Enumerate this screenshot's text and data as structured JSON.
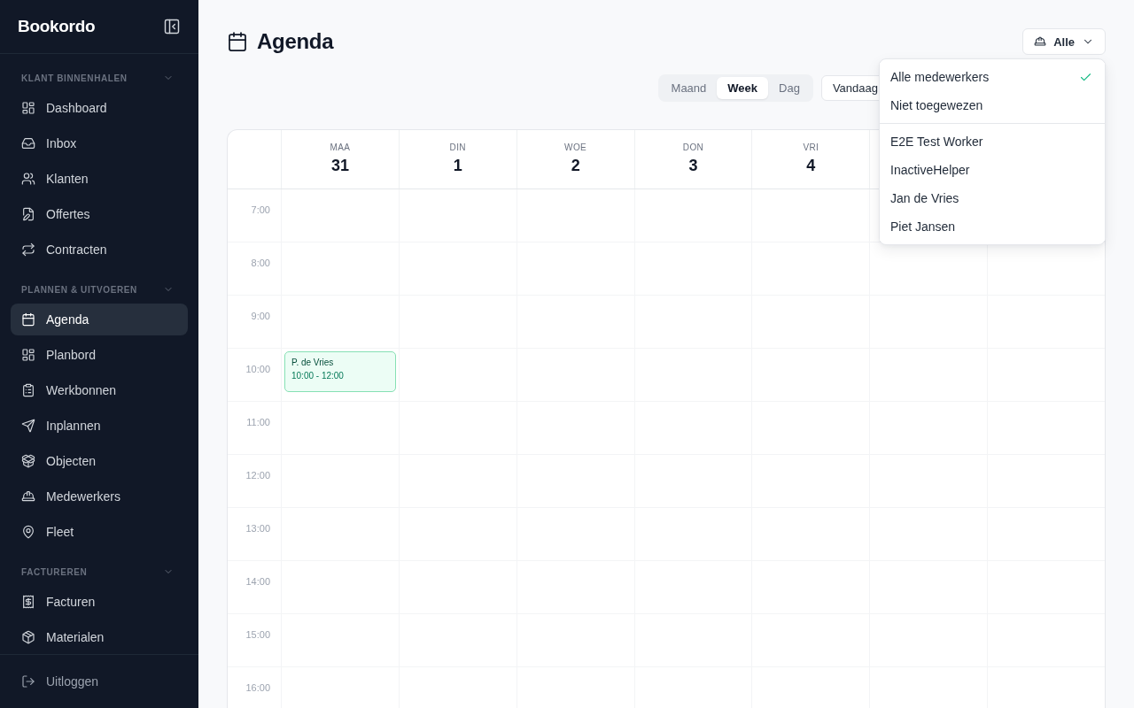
{
  "sidebar": {
    "logo": "Bookordo",
    "sections": [
      {
        "title": "KLANT BINNENHALEN",
        "expanded": true,
        "items": [
          {
            "label": "Dashboard",
            "selected": false
          },
          {
            "label": "Inbox",
            "selected": false
          },
          {
            "label": "Klanten",
            "selected": false
          },
          {
            "label": "Offertes",
            "selected": false
          },
          {
            "label": "Contracten",
            "selected": false
          }
        ]
      },
      {
        "title": "PLANNEN & UITVOEREN",
        "expanded": true,
        "items": [
          {
            "label": "Agenda",
            "selected": true
          },
          {
            "label": "Planbord",
            "selected": false
          },
          {
            "label": "Werkbonnen",
            "selected": false
          },
          {
            "label": "Inplannen",
            "selected": false
          },
          {
            "label": "Objecten",
            "selected": false
          },
          {
            "label": "Medewerkers",
            "selected": false
          },
          {
            "label": "Fleet",
            "selected": false
          }
        ]
      },
      {
        "title": "FACTUREREN",
        "expanded": true,
        "items": [
          {
            "label": "Facturen",
            "selected": false
          },
          {
            "label": "Materialen",
            "selected": false
          }
        ]
      }
    ],
    "footer": {
      "label": "Uitloggen"
    }
  },
  "header": {
    "title": "Agenda",
    "filter": {
      "value": "Alle",
      "open": true,
      "menu": {
        "groups": [
          {
            "items": [
              {
                "label": "Alle medewerkers",
                "selected": true
              },
              {
                "label": "Niet toegewezen",
                "selected": false
              }
            ]
          },
          {
            "items": [
              {
                "label": "E2E Test Worker",
                "selected": false
              },
              {
                "label": "InactiveHelper",
                "selected": false
              },
              {
                "label": "Jan de Vries",
                "selected": false
              },
              {
                "label": "Piet Jansen",
                "selected": false
              }
            ]
          }
        ]
      }
    }
  },
  "toolbar": {
    "views": [
      {
        "label": "Maand",
        "selected": false
      },
      {
        "label": "Week",
        "selected": true
      },
      {
        "label": "Dag",
        "selected": false
      }
    ],
    "today": "Vandaag"
  },
  "calendar": {
    "days": [
      {
        "weekday": "MAA",
        "date": "31"
      },
      {
        "weekday": "DIN",
        "date": "1"
      },
      {
        "weekday": "WOE",
        "date": "2"
      },
      {
        "weekday": "DON",
        "date": "3"
      },
      {
        "weekday": "VRI",
        "date": "4"
      }
    ],
    "rows": [
      {
        "time": "7:00"
      },
      {
        "time": "8:00"
      },
      {
        "time": "9:00"
      },
      {
        "time": "10:00",
        "cells": [
          {
            "events": [
              {
                "title": "P. de Vries",
                "time": "10:00 - 12:00"
              }
            ]
          }
        ]
      },
      {
        "time": "11:00"
      },
      {
        "time": "12:00"
      },
      {
        "time": "13:00"
      },
      {
        "time": "14:00"
      },
      {
        "time": "15:00"
      },
      {
        "time": "16:00"
      }
    ]
  }
}
